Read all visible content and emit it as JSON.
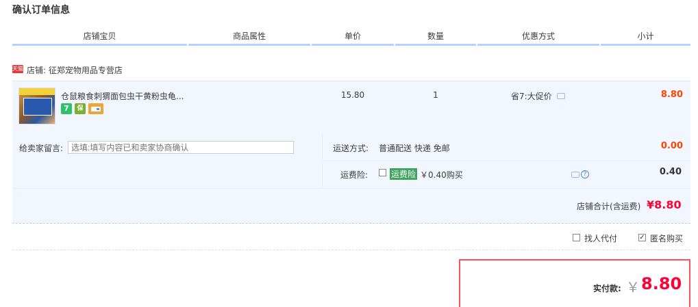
{
  "page": {
    "title": "确认订单信息"
  },
  "table_header": [
    "店铺宝贝",
    "商品属性",
    "单价",
    "数量",
    "优惠方式",
    "小计"
  ],
  "shop": {
    "badge": "天猫",
    "label": "店铺: 征郑宠物用品专营店"
  },
  "item": {
    "name": "仓鼠粮食刺猬面包虫干黄粉虫龟...",
    "unit_price": "15.80",
    "quantity": "1",
    "discount": "省7:大促价",
    "subtotal": "8.80",
    "badges": [
      {
        "name": "seven-day-return-icon",
        "text": "7",
        "color": "#2ec26a"
      },
      {
        "name": "guarantee-icon",
        "text": "保",
        "color": "#7ab02e"
      },
      {
        "name": "credit-card-icon",
        "text": "",
        "color": "#f1a33b"
      }
    ]
  },
  "message": {
    "label": "给卖家留言:",
    "placeholder": "选填:填写内容已和卖家协商确认"
  },
  "shipping": {
    "label": "运送方式:",
    "value": "普通配送 快递 免邮",
    "price": "0.00"
  },
  "insurance": {
    "label": "运费险:",
    "tag": "运费险",
    "desc": "￥0.40购买",
    "price": "0.40"
  },
  "shop_total": {
    "label": "店铺合计(含运费)",
    "value": "¥8.80"
  },
  "options": {
    "proxy_pay": "找人代付",
    "anonymous": "匿名购买",
    "anonymous_checked": true,
    "proxy_checked": false
  },
  "payment": {
    "label": "实付款:",
    "currency": "￥",
    "value": "8.80"
  },
  "colors": {
    "accent": "#ff0036",
    "header_line": "#b2d1ff",
    "row_bg": "#f2f7ff"
  }
}
